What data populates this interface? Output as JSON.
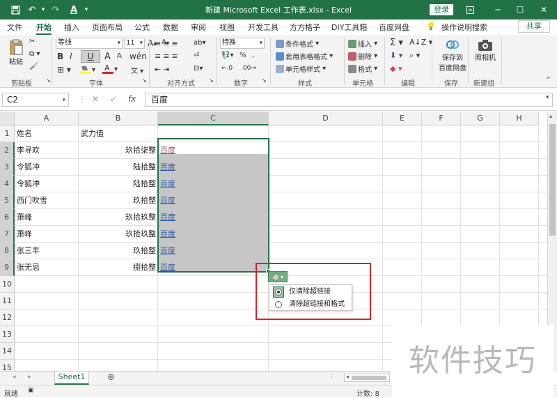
{
  "titlebar": {
    "title": "新建 Microsoft Excel 工作表.xlsx  -  Excel",
    "login": "登录",
    "save_icon": "save-icon",
    "undo_icon": "undo-icon",
    "redo_icon": "redo-icon",
    "font_color_icon": "font-color-icon",
    "accent": "#217346"
  },
  "tabs": [
    "文件",
    "开始",
    "插入",
    "页面布局",
    "公式",
    "数据",
    "审阅",
    "视图",
    "开发工具",
    "方方格子",
    "DIY工具箱",
    "百度网盘",
    "操作说明搜索"
  ],
  "active_tab": "开始",
  "share": "共享",
  "ribbon": {
    "clipboard": {
      "label": "剪贴板",
      "paste": "粘贴"
    },
    "font": {
      "label": "字体",
      "font_name": "等线",
      "font_size": "11",
      "bold": "B",
      "italic": "I",
      "underline": "U"
    },
    "alignment": {
      "label": "对齐方式"
    },
    "number": {
      "label": "数字",
      "format": "特殊"
    },
    "styles": {
      "label": "样式",
      "conditional": "条件格式",
      "table": "套用表格格式",
      "cell": "单元格样式"
    },
    "cells": {
      "label": "单元格",
      "insert": "插入",
      "delete": "删除",
      "format": "格式"
    },
    "editing": {
      "label": "编辑"
    },
    "save": {
      "label": "保存",
      "baidu": "保存到",
      "baidu2": "百度网盘"
    },
    "newgroup": {
      "label": "新建组",
      "camera": "照相机"
    }
  },
  "formula_bar": {
    "name_box": "C2",
    "cancel": "✕",
    "enter": "✓",
    "fx": "fx",
    "value": "百度"
  },
  "columns": [
    "A",
    "B",
    "C",
    "D",
    "E",
    "F",
    "G",
    "H"
  ],
  "rows": [
    "1",
    "2",
    "3",
    "4",
    "5",
    "6",
    "7",
    "8",
    "9",
    "10",
    "11",
    "12",
    "13",
    "14",
    "15"
  ],
  "cells": {
    "A": [
      "姓名",
      "李寻欢",
      "令狐冲",
      "令狐冲",
      "西门吹雪",
      "萧峰",
      "萧峰",
      "张三丰",
      "张无忌"
    ],
    "B": [
      "武力值",
      "玖拾柒整",
      "陆拾整",
      "陆拾整",
      "玖拾整",
      "玖拾玖整",
      "玖拾玖整",
      "玖拾整",
      "捌拾整"
    ],
    "C": [
      "",
      "百度",
      "百度",
      "百度",
      "百度",
      "百度",
      "百度",
      "百度",
      "百度"
    ]
  },
  "popup": {
    "options": [
      "仅清除超链接",
      "清除超链接和格式"
    ],
    "selected": 0
  },
  "sheet": {
    "tab": "Sheet1",
    "add": "⊕"
  },
  "status": {
    "ready": "就绪",
    "count": "计数: 8"
  },
  "watermark": "软件技巧"
}
